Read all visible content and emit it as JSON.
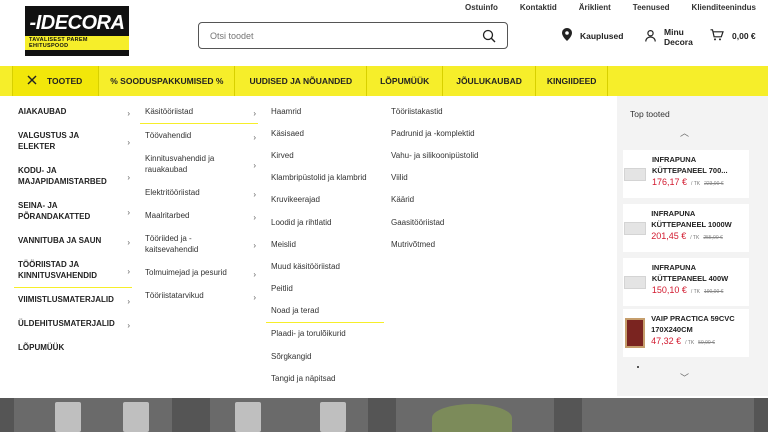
{
  "header": {
    "top_links": [
      "Ostuinfo",
      "Kontaktid",
      "Äriklient",
      "Teenused",
      "Klienditeenindus"
    ],
    "logo_text": "DECORA",
    "logo_tagline": "TAVALISEST PAREM EHITUSPOOD",
    "search_placeholder": "Otsi toodet",
    "stores_label": "Kauplused",
    "account_label_1": "Minu",
    "account_label_2": "Decora",
    "cart_total": "0,00 €"
  },
  "nav": {
    "items": [
      "TOOTED",
      "% SOODUSPAKKUMISED %",
      "UUDISED JA NÕUANDED",
      "LÕPUMÜÜK",
      "JÕULUKAUBAD",
      "KINGIIDEED"
    ]
  },
  "menu": {
    "level1": [
      "AIAKAUBAD",
      "VALGUSTUS JA ELEKTER",
      "KODU- JA MAJAPIDAMISTARBED",
      "SEINA- JA PÕRANDAKATTED",
      "VANNITUBA JA SAUN",
      "TÖÖRIISTAD JA KINNITUSVAHENDID",
      "VIIMISTLUSMATERJALID",
      "ÜLDEHITUSMATERJALID",
      "LÕPUMÜÜK"
    ],
    "level2": [
      "Käsitööriistad",
      "Töövahendid",
      "Kinnitusvahendid ja rauakaubad",
      "Elektritööriistad",
      "Maalritarbed",
      "Tööriided ja -kaitsevahendid",
      "Tolmuimejad ja pesurid",
      "Tööriistatarvikud"
    ],
    "level3": [
      "Haamrid",
      "Käsisaed",
      "Kirved",
      "Klambripüstolid ja klambrid",
      "Kruvikeerajad",
      "Loodid ja rihtlatid",
      "Meislid",
      "Muud käsitööriistad",
      "Peitlid",
      "Noad ja terad",
      "Plaadi- ja torulõikurid",
      "Sõrgkangid",
      "Tangid ja näpitsad"
    ],
    "level4": [
      "Tööriistakastid",
      "Padrunid ja -komplektid",
      "Vahu- ja silikoonipüstolid",
      "Viilid",
      "Käärid",
      "Gaasitööriistad",
      "Mutrivõtmed"
    ]
  },
  "top_products": {
    "title": "Top tooted",
    "items": [
      {
        "name": "INFRAPUNA KÜTTEPANEEL 700...",
        "price": "176,17 €",
        "unit": "/ TK",
        "old_price": "223,00 €"
      },
      {
        "name": "INFRAPUNA KÜTTEPANEEL 1000W",
        "price": "201,45 €",
        "unit": "/ TK",
        "old_price": "255,00 €"
      },
      {
        "name": "INFRAPUNA KÜTTEPANEEL 400W",
        "price": "150,10 €",
        "unit": "/ TK",
        "old_price": "190,00 €"
      },
      {
        "name": "VAIP PRACTICA 59CVC 170X240CM",
        "price": "47,32 €",
        "unit": "/ TK",
        "old_price": "59,90 €"
      }
    ]
  },
  "colors": {
    "brand_yellow": "#f6ee2a",
    "price_red": "#d21a2f"
  }
}
